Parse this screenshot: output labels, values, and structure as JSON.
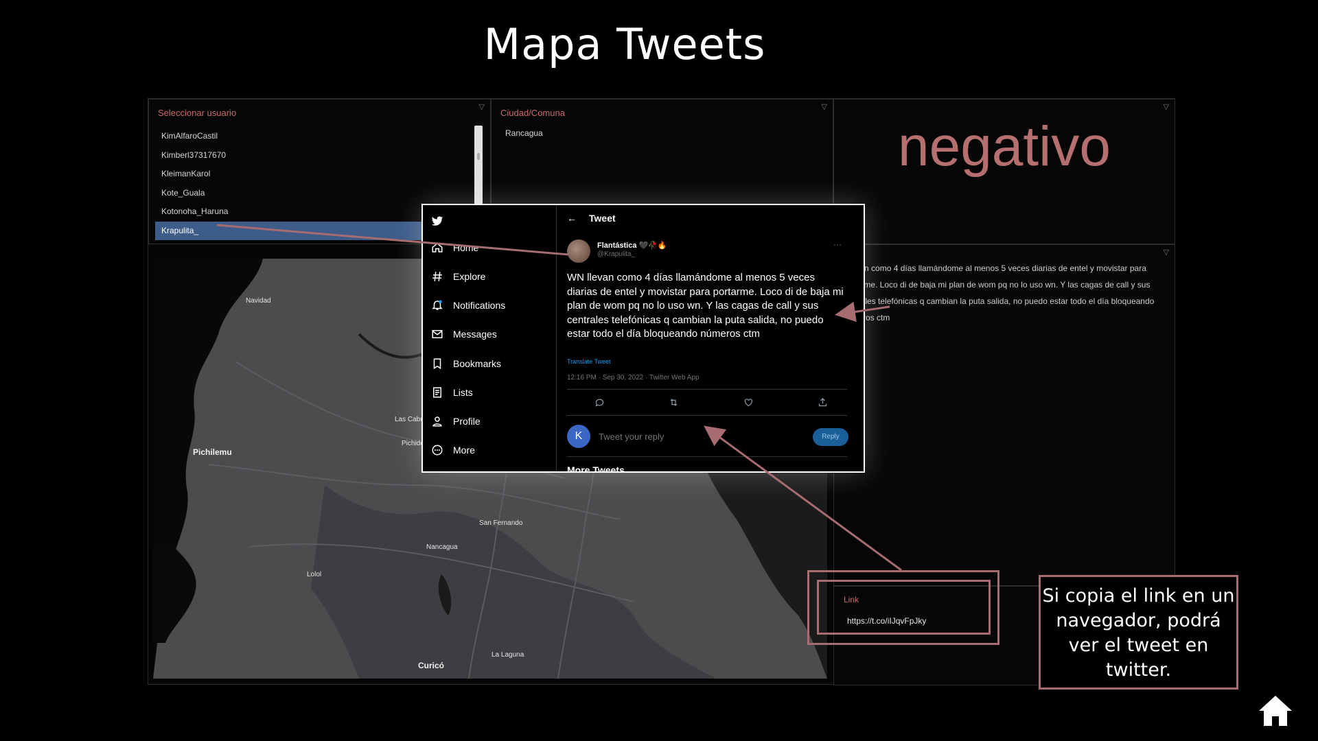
{
  "slide": {
    "title": "Mapa Tweets"
  },
  "filters": {
    "user_label": "Seleccionar usuario",
    "users": [
      "KimAlfaroCastil",
      "Kimberl37317670",
      "KleimanKarol",
      "Kote_Guala",
      "Kotonoha_Haruna",
      "Krapulita_"
    ],
    "city_label": "Ciudad/Comuna",
    "city_value": "Rancagua"
  },
  "sentiment": {
    "value": "negativo"
  },
  "tweet_panel": {
    "text": "...levan como 4 días llamándome al menos 5 veces diarias de entel y movistar para portarme. Loco di de baja mi plan de wom pq no lo uso wn. Y las cagas de call y sus centrales telefónicas q cambian la puta salida, no puedo estar todo el día bloqueando números ctm"
  },
  "link_panel": {
    "label": "Link",
    "value": "https://t.co/iIJqvFpJky"
  },
  "map": {
    "labels": [
      "Navidad",
      "Las Cabras",
      "Pichidegua",
      "Pichilemu",
      "San Fernando",
      "Nancagua",
      "Lolol",
      "La Laguna",
      "Curicó"
    ]
  },
  "twitter": {
    "nav": [
      "Home",
      "Explore",
      "Notifications",
      "Messages",
      "Bookmarks",
      "Lists",
      "Profile",
      "More"
    ],
    "header": "Tweet",
    "author_name": "Flantástica 🖤🥀🔥",
    "author_handle": "@Krapulita_",
    "body": "WN llevan como 4 días llamándome al menos 5 veces diarias de entel y movistar para portarme. Loco di de baja mi plan de wom pq no lo uso wn. Y las cagas de call y sus centrales telefónicas q cambian la puta salida, no puedo estar todo el día bloqueando números ctm",
    "translate": "Translate Tweet",
    "meta": "12:16 PM · Sep 30, 2022 · Twitter Web App",
    "reply_avatar": "K",
    "reply_placeholder": "Tweet your reply",
    "reply_button": "Reply",
    "more_tweets": "More Tweets"
  },
  "callout": {
    "text": "Si copia el link en un navegador, podrá ver el tweet en twitter."
  },
  "colors": {
    "accent": "#a66c70",
    "label": "#c96c6c",
    "selection": "#3d5c8a",
    "twitter_blue": "#1d9bf0"
  }
}
